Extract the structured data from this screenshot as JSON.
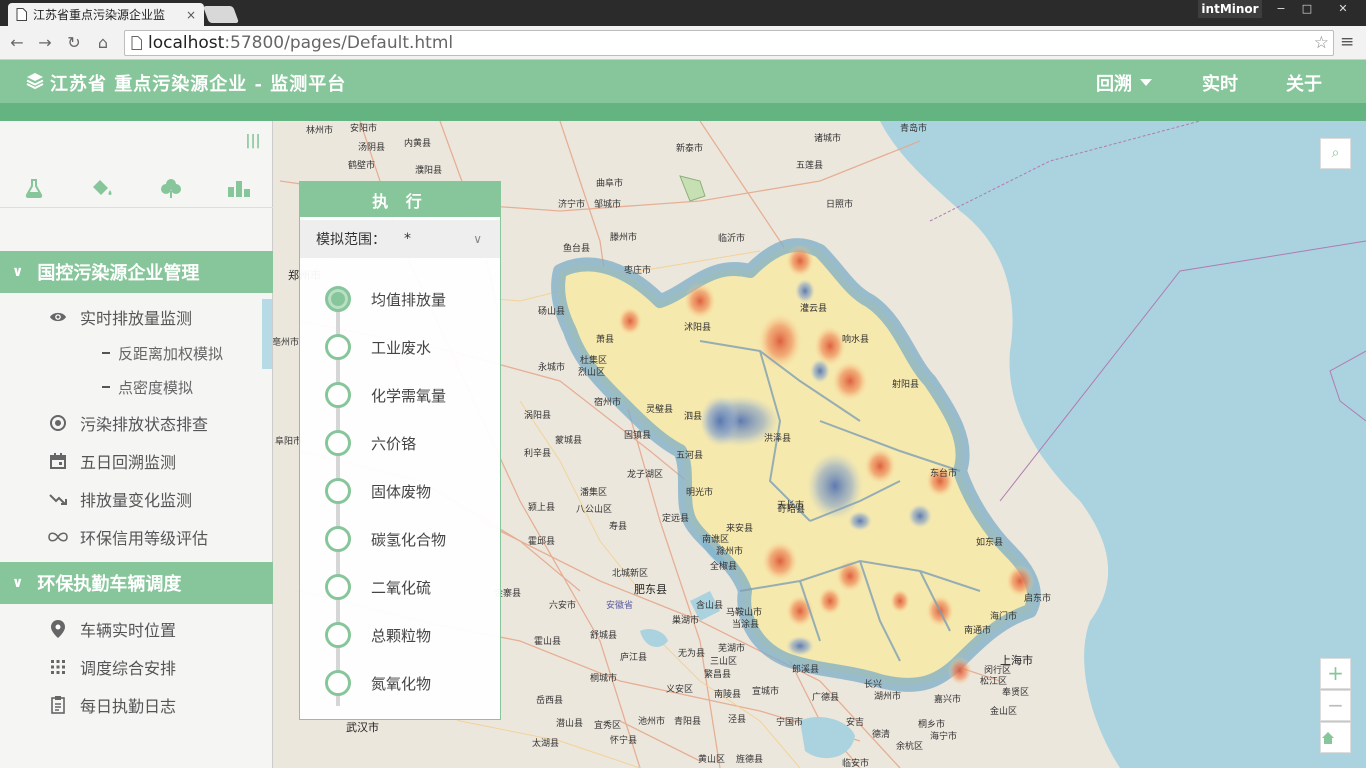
{
  "browser": {
    "tab_title": "江苏省重点污染源企业监",
    "tab_close": "×",
    "profile": "intMinor",
    "url_host": "localhost",
    "url_path": ":57800/pages/Default.html",
    "window_controls": [
      "−",
      "□",
      "✕"
    ]
  },
  "header": {
    "title": "江苏省 重点污染源企业 - 监测平台",
    "nav": [
      {
        "label": "回溯"
      },
      {
        "label": "实时"
      },
      {
        "label": "关于"
      }
    ]
  },
  "sidebar": {
    "collapse_label": "|||",
    "tools": [
      "flask-icon",
      "paint-bucket-icon",
      "tree-icon",
      "bar-chart-icon"
    ],
    "sections": [
      {
        "label": "国控污染源企业管理",
        "items": [
          {
            "label": "实时排放量监测",
            "icon": "eye-icon"
          },
          {
            "label": "反距离加权模拟",
            "sub": true
          },
          {
            "label": "点密度模拟",
            "sub": true
          },
          {
            "label": "污染排放状态排查",
            "icon": "target-icon"
          },
          {
            "label": "五日回溯监测",
            "icon": "calendar-icon"
          },
          {
            "label": "排放量变化监测",
            "icon": "trend-icon"
          },
          {
            "label": "环保信用等级评估",
            "icon": "infinity-icon"
          }
        ]
      },
      {
        "label": "环保执勤车辆调度",
        "items": [
          {
            "label": "车辆实时位置",
            "icon": "map-pin-icon"
          },
          {
            "label": "调度综合安排",
            "icon": "grid-icon"
          },
          {
            "label": "每日执勤日志",
            "icon": "clipboard-icon"
          }
        ]
      }
    ]
  },
  "exec_panel": {
    "title": "执 行",
    "range_label": "模拟范围：",
    "range_value": "*",
    "steps": [
      {
        "label": "均值排放量",
        "active": true
      },
      {
        "label": "工业废水"
      },
      {
        "label": "化学需氧量"
      },
      {
        "label": "六价铬"
      },
      {
        "label": "固体废物"
      },
      {
        "label": "碳氢化合物"
      },
      {
        "label": "二氧化硫"
      },
      {
        "label": "总颗粒物"
      },
      {
        "label": "氮氧化物"
      }
    ]
  },
  "map": {
    "labels": [
      {
        "text": "林州市"
      },
      {
        "text": "安阳市"
      },
      {
        "text": "汤阴县"
      },
      {
        "text": "内黄县"
      },
      {
        "text": "鹤壁市"
      },
      {
        "text": "濮阳县"
      },
      {
        "text": "新泰市"
      },
      {
        "text": "诸城市"
      },
      {
        "text": "青岛市"
      },
      {
        "text": "五莲县"
      },
      {
        "text": "曲阜市"
      },
      {
        "text": "济宁市"
      },
      {
        "text": "邹城市"
      },
      {
        "text": "日照市"
      },
      {
        "text": "滕州市"
      },
      {
        "text": "临沂市"
      },
      {
        "text": "鱼台县"
      },
      {
        "text": "枣庄市"
      },
      {
        "text": "砀山县"
      },
      {
        "text": "萧县"
      },
      {
        "text": "永城市"
      },
      {
        "text": "杜集区"
      },
      {
        "text": "烈山区"
      },
      {
        "text": "宿州市"
      },
      {
        "text": "灵璧县"
      },
      {
        "text": "泗县"
      },
      {
        "text": "涡阳县"
      },
      {
        "text": "蒙城县"
      },
      {
        "text": "固镇县"
      },
      {
        "text": "五河县"
      },
      {
        "text": "利辛县"
      },
      {
        "text": "龙子湖区"
      },
      {
        "text": "潘集区"
      },
      {
        "text": "八公山区"
      },
      {
        "text": "明光市"
      },
      {
        "text": "颍上县"
      },
      {
        "text": "定远县"
      },
      {
        "text": "天长市"
      },
      {
        "text": "来安县"
      },
      {
        "text": "寿县"
      },
      {
        "text": "南谯区"
      },
      {
        "text": "滁州市"
      },
      {
        "text": "全椒县"
      },
      {
        "text": "霍邱县"
      },
      {
        "text": "北城新区"
      },
      {
        "text": "肥东县"
      },
      {
        "text": "金寨县"
      },
      {
        "text": "六安市"
      },
      {
        "text": "安徽省"
      },
      {
        "text": "含山县"
      },
      {
        "text": "马鞍山市"
      },
      {
        "text": "当涂县"
      },
      {
        "text": "巢湖市"
      },
      {
        "text": "舒城县"
      },
      {
        "text": "霍山县"
      },
      {
        "text": "庐江县"
      },
      {
        "text": "无为县"
      },
      {
        "text": "芜湖市"
      },
      {
        "text": "三山区"
      },
      {
        "text": "繁昌县"
      },
      {
        "text": "郎溪县"
      },
      {
        "text": "桐城市"
      },
      {
        "text": "岳西县"
      },
      {
        "text": "义安区"
      },
      {
        "text": "南陵县"
      },
      {
        "text": "宣城市"
      },
      {
        "text": "广德县"
      },
      {
        "text": "长兴"
      },
      {
        "text": "湖州市"
      },
      {
        "text": "潜山县"
      },
      {
        "text": "宜秀区"
      },
      {
        "text": "池州市"
      },
      {
        "text": "青阳县"
      },
      {
        "text": "泾县"
      },
      {
        "text": "宁国市"
      },
      {
        "text": "安吉"
      },
      {
        "text": "德清"
      },
      {
        "text": "余杭区"
      },
      {
        "text": "太湖县"
      },
      {
        "text": "怀宁县"
      },
      {
        "text": "黄山区"
      },
      {
        "text": "旌德县"
      },
      {
        "text": "临安市"
      },
      {
        "text": "桐乡市"
      },
      {
        "text": "海宁市"
      },
      {
        "text": "嘉兴市"
      },
      {
        "text": "上海市"
      },
      {
        "text": "松江区"
      },
      {
        "text": "奉贤区"
      },
      {
        "text": "金山区"
      },
      {
        "text": "闵行区"
      },
      {
        "text": "启东市"
      },
      {
        "text": "海门市"
      },
      {
        "text": "南通市"
      },
      {
        "text": "如东县"
      },
      {
        "text": "东台市"
      },
      {
        "text": "射阳县"
      },
      {
        "text": "响水县"
      },
      {
        "text": "灌云县"
      },
      {
        "text": "洪泽县"
      },
      {
        "text": "盱眙县"
      },
      {
        "text": "沭阳县"
      },
      {
        "text": "郑州市"
      },
      {
        "text": "武汉市"
      },
      {
        "text": "亳州市"
      },
      {
        "text": "阜阳市"
      }
    ]
  },
  "map_controls": {
    "search": "search-icon",
    "zoom_in": "+",
    "zoom_out": "−",
    "home": "home-icon"
  }
}
